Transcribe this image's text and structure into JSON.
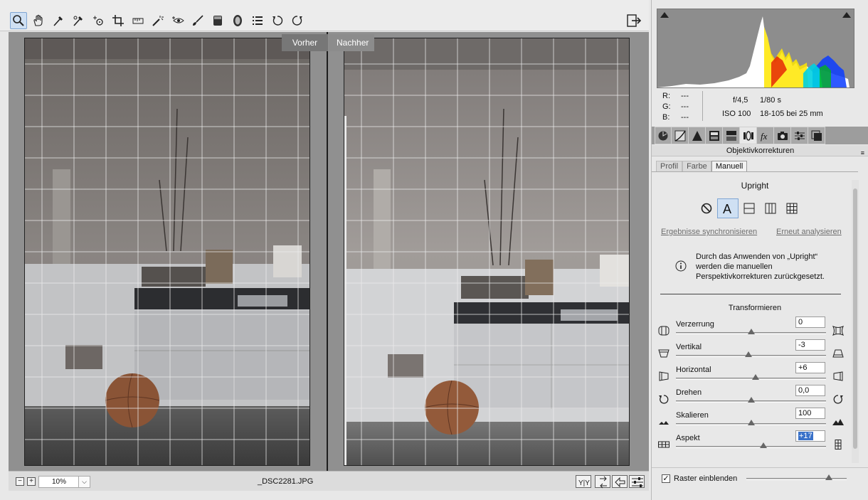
{
  "toolbar": {
    "tools": [
      "zoom-tool-icon",
      "hand-tool-icon",
      "white-balance-tool-icon",
      "color-sampler-tool-icon",
      "target-adjustment-tool-icon",
      "crop-tool-icon",
      "straighten-tool-icon",
      "spot-removal-tool-icon",
      "red-eye-tool-icon",
      "adjustment-brush-icon",
      "graduated-filter-icon",
      "radial-filter-icon",
      "preferences-list-icon",
      "rotate-left-icon",
      "rotate-right-icon"
    ],
    "active_tool": "zoom-tool-icon"
  },
  "view": {
    "before_label": "Vorher",
    "after_label": "Nachher"
  },
  "statusbar": {
    "zoom": "10%",
    "filename": "_DSC2281.JPG"
  },
  "info": {
    "r_label": "R:",
    "r_value": "---",
    "g_label": "G:",
    "g_value": "---",
    "b_label": "B:",
    "b_value": "---",
    "aperture": "f/4,5",
    "shutter": "1/80 s",
    "iso": "ISO 100",
    "lens": "18-105 bei 25 mm"
  },
  "panel": {
    "title": "Objektivkorrekturen",
    "subtabs": [
      "Profil",
      "Farbe",
      "Manuell"
    ],
    "active_subtab": "Manuell",
    "upright_title": "Upright",
    "sync_link": "Ergebnisse synchronisieren",
    "reanalyze_link": "Erneut analysieren",
    "notice_lines": [
      "Durch das Anwenden von „Upright“",
      "werden die manuellen",
      "Perspektivkorrekturen zurückgesetzt."
    ],
    "transform_title": "Transformieren",
    "sliders": [
      {
        "label": "Verzerrung",
        "value": "0",
        "pos": 0.5
      },
      {
        "label": "Vertikal",
        "value": "-3",
        "pos": 0.485
      },
      {
        "label": "Horizontal",
        "value": "+6",
        "pos": 0.53
      },
      {
        "label": "Drehen",
        "value": "0,0",
        "pos": 0.5
      },
      {
        "label": "Skalieren",
        "value": "100",
        "pos": 0.5
      },
      {
        "label": "Aspekt",
        "value": "+17",
        "pos": 0.585
      }
    ],
    "grid_label": "Raster einblenden",
    "grid_checked": true,
    "grid_size": 0.83
  },
  "colors": {
    "accent": "#3a72c9",
    "active_bg": "#cfe0f3"
  }
}
